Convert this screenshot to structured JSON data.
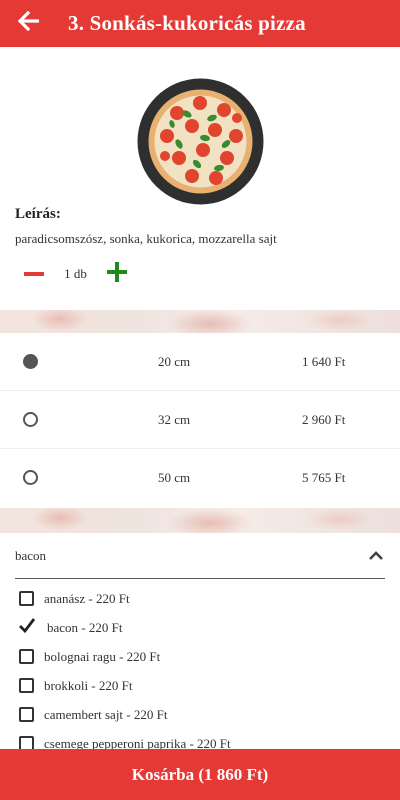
{
  "header": {
    "title": "3. Sonkás-kukoricás pizza",
    "back_icon": "arrow-left-icon",
    "color": "#e53935"
  },
  "product": {
    "image_icon": "pizza-image",
    "description_label": "Leírás:",
    "description": "paradicsomszósz, sonka, kukorica, mozzarella sajt"
  },
  "quantity": {
    "value": "1 db",
    "minus_icon": "minus-icon",
    "plus_icon": "plus-icon",
    "minus_color": "#e53935",
    "plus_color": "#1e8a1e"
  },
  "sizes": [
    {
      "label": "20 cm",
      "price": "1 640 Ft",
      "selected": true
    },
    {
      "label": "32 cm",
      "price": "2 960 Ft",
      "selected": false
    },
    {
      "label": "50 cm",
      "price": "5 765 Ft",
      "selected": false
    }
  ],
  "extras": {
    "selected_summary": "bacon",
    "expanded": true,
    "items": [
      {
        "label": "ananász - 220 Ft",
        "checked": false
      },
      {
        "label": "bacon - 220 Ft",
        "checked": true
      },
      {
        "label": "bolognai ragu - 220 Ft",
        "checked": false
      },
      {
        "label": "brokkoli - 220 Ft",
        "checked": false
      },
      {
        "label": "camembert sajt - 220 Ft",
        "checked": false
      },
      {
        "label": "csemege pepperoni paprika - 220 Ft",
        "checked": false
      }
    ]
  },
  "footer": {
    "cart_label": "Kosárba (1 860 Ft)",
    "color": "#e53935"
  }
}
